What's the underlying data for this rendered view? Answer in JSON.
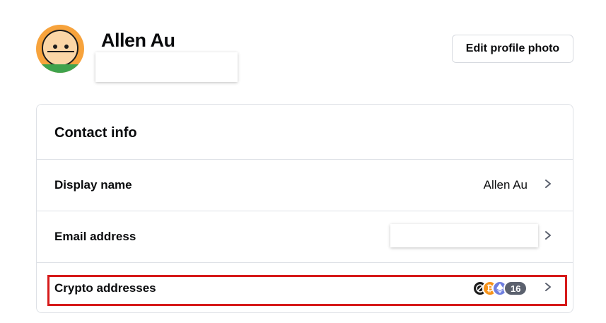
{
  "profile": {
    "name": "Allen Au",
    "edit_photo_label": "Edit profile photo"
  },
  "contact_info": {
    "title": "Contact info",
    "rows": [
      {
        "label": "Display name",
        "value": "Allen Au"
      },
      {
        "label": "Email address",
        "value": ""
      },
      {
        "label": "Crypto addresses",
        "coin_icons": [
          "bitcoin-cash-icon",
          "bitcoin-icon",
          "ethereum-icon"
        ],
        "more_count": "16"
      }
    ]
  },
  "colors": {
    "highlight": "#d61a1a",
    "bitcoin": "#f7931a",
    "ethereum": "#6f7fe0"
  }
}
